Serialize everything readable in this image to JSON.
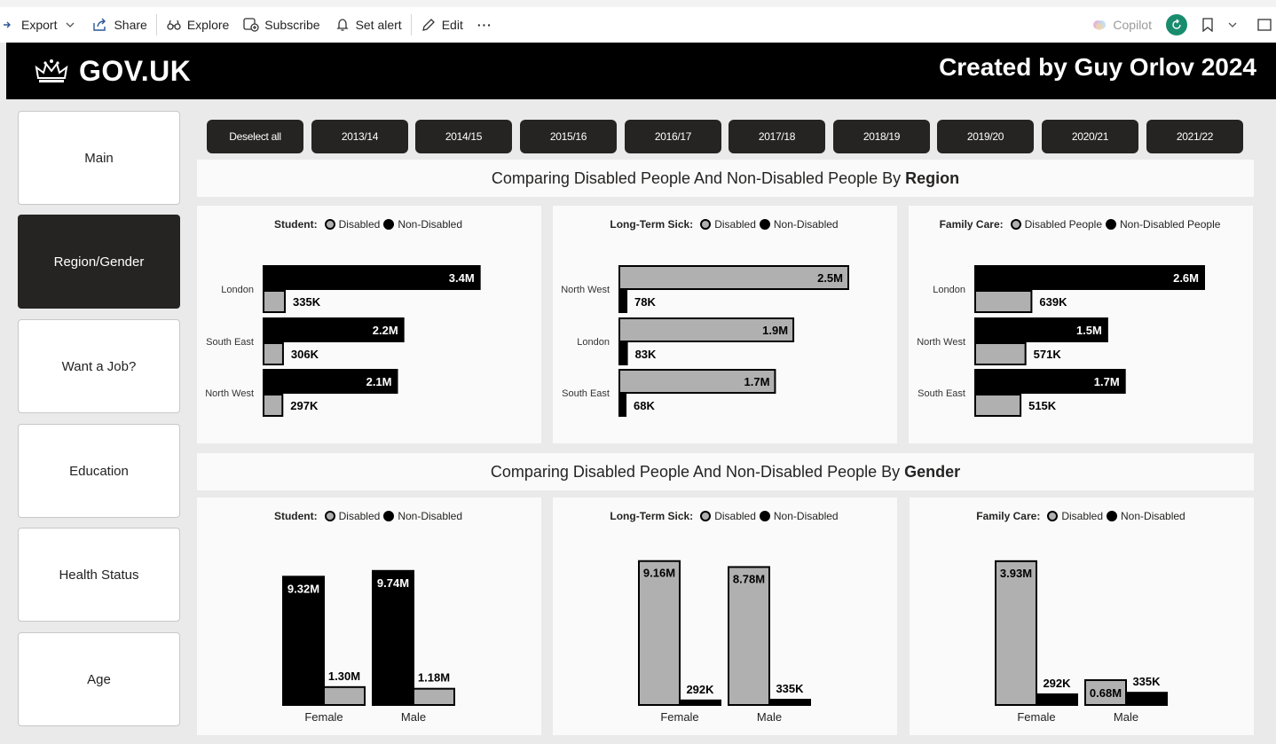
{
  "toolbar": {
    "export": "Export",
    "share": "Share",
    "explore": "Explore",
    "subscribe": "Subscribe",
    "set_alert": "Set alert",
    "edit": "Edit",
    "more": "···",
    "copilot": "Copilot"
  },
  "banner": {
    "logo_text": "GOV.UK",
    "credit": "Created by Guy Orlov 2024"
  },
  "nav": [
    "Main",
    "Region/Gender",
    "Want a Job?",
    "Education",
    "Health Status",
    "Age"
  ],
  "nav_active": 1,
  "years": [
    "Deselect all",
    "2013/14",
    "2014/15",
    "2015/16",
    "2016/17",
    "2017/18",
    "2018/19",
    "2019/20",
    "2020/21",
    "2021/22"
  ],
  "sections": {
    "region": {
      "prefix": "Comparing Disabled People And Non-Disabled People By",
      "bold": "Region"
    },
    "gender": {
      "prefix": "Comparing Disabled People And Non-Disabled People By",
      "bold": "Gender"
    }
  },
  "colors": {
    "disabled": "#b0b0b0",
    "non_disabled": "#000000",
    "accent_nav": "#252423"
  },
  "chart_data": [
    {
      "type": "bar",
      "orientation": "horizontal",
      "legend_title": "Student:",
      "legend": [
        "Disabled",
        "Non-Disabled"
      ],
      "categories": [
        "London",
        "South East",
        "North West"
      ],
      "series": [
        {
          "name": "Non-Disabled",
          "values": [
            3.4,
            2.2,
            2.1
          ],
          "labels": [
            "3.4M",
            "2.2M",
            "2.1M"
          ]
        },
        {
          "name": "Disabled",
          "values": [
            0.335,
            0.306,
            0.297
          ],
          "labels": [
            "335K",
            "306K",
            "297K"
          ]
        }
      ],
      "xlim": [
        0,
        3.6
      ]
    },
    {
      "type": "bar",
      "orientation": "horizontal",
      "legend_title": "Long-Term Sick:",
      "legend": [
        "Disabled",
        "Non-Disabled"
      ],
      "categories": [
        "North West",
        "London",
        "South East"
      ],
      "series": [
        {
          "name": "Disabled",
          "values": [
            2.5,
            1.9,
            1.7
          ],
          "labels": [
            "2.5M",
            "1.9M",
            "1.7M"
          ]
        },
        {
          "name": "Non-Disabled",
          "values": [
            0.078,
            0.083,
            0.068
          ],
          "labels": [
            "78K",
            "83K",
            "68K"
          ]
        }
      ],
      "xlim": [
        0,
        2.5
      ]
    },
    {
      "type": "bar",
      "orientation": "horizontal",
      "legend_title": "Family Care:",
      "legend": [
        "Disabled People",
        "Non-Disabled People"
      ],
      "categories": [
        "London",
        "North West",
        "South East"
      ],
      "series": [
        {
          "name": "Non-Disabled People",
          "values": [
            2.6,
            1.5,
            1.7
          ],
          "labels": [
            "2.6M",
            "1.5M",
            "1.7M"
          ]
        },
        {
          "name": "Disabled People",
          "values": [
            0.639,
            0.571,
            0.515
          ],
          "labels": [
            "639K",
            "571K",
            "515K"
          ]
        }
      ],
      "xlim": [
        0,
        2.6
      ]
    },
    {
      "type": "bar",
      "orientation": "vertical",
      "legend_title": "Student:",
      "legend": [
        "Disabled",
        "Non-Disabled"
      ],
      "categories": [
        "Female",
        "Male"
      ],
      "series": [
        {
          "name": "Non-Disabled",
          "values": [
            9.32,
            9.74
          ],
          "labels": [
            "9.32M",
            "9.74M"
          ]
        },
        {
          "name": "Disabled",
          "values": [
            1.3,
            1.18
          ],
          "labels": [
            "1.30M",
            "1.18M"
          ]
        }
      ],
      "ylim": [
        0,
        10.5
      ]
    },
    {
      "type": "bar",
      "orientation": "vertical",
      "legend_title": "Long-Term Sick:",
      "legend": [
        "Disabled",
        "Non-Disabled"
      ],
      "categories": [
        "Female",
        "Male"
      ],
      "series": [
        {
          "name": "Disabled",
          "values": [
            9.16,
            8.78
          ],
          "labels": [
            "9.16M",
            "8.78M"
          ]
        },
        {
          "name": "Non-Disabled",
          "values": [
            0.292,
            0.335
          ],
          "labels": [
            "292K",
            "335K"
          ]
        }
      ],
      "ylim": [
        0,
        9.2
      ]
    },
    {
      "type": "bar",
      "orientation": "vertical",
      "legend_title": "Family Care:",
      "legend": [
        "Disabled",
        "Non-Disabled"
      ],
      "categories": [
        "Female",
        "Male"
      ],
      "series": [
        {
          "name": "Disabled",
          "values": [
            3.93,
            0.68
          ],
          "labels": [
            "3.93M",
            "0.68M"
          ]
        },
        {
          "name": "Non-Disabled",
          "values": [
            0.292,
            0.335
          ],
          "labels": [
            "292K",
            "335K"
          ]
        }
      ],
      "ylim": [
        0,
        3.95
      ]
    }
  ]
}
